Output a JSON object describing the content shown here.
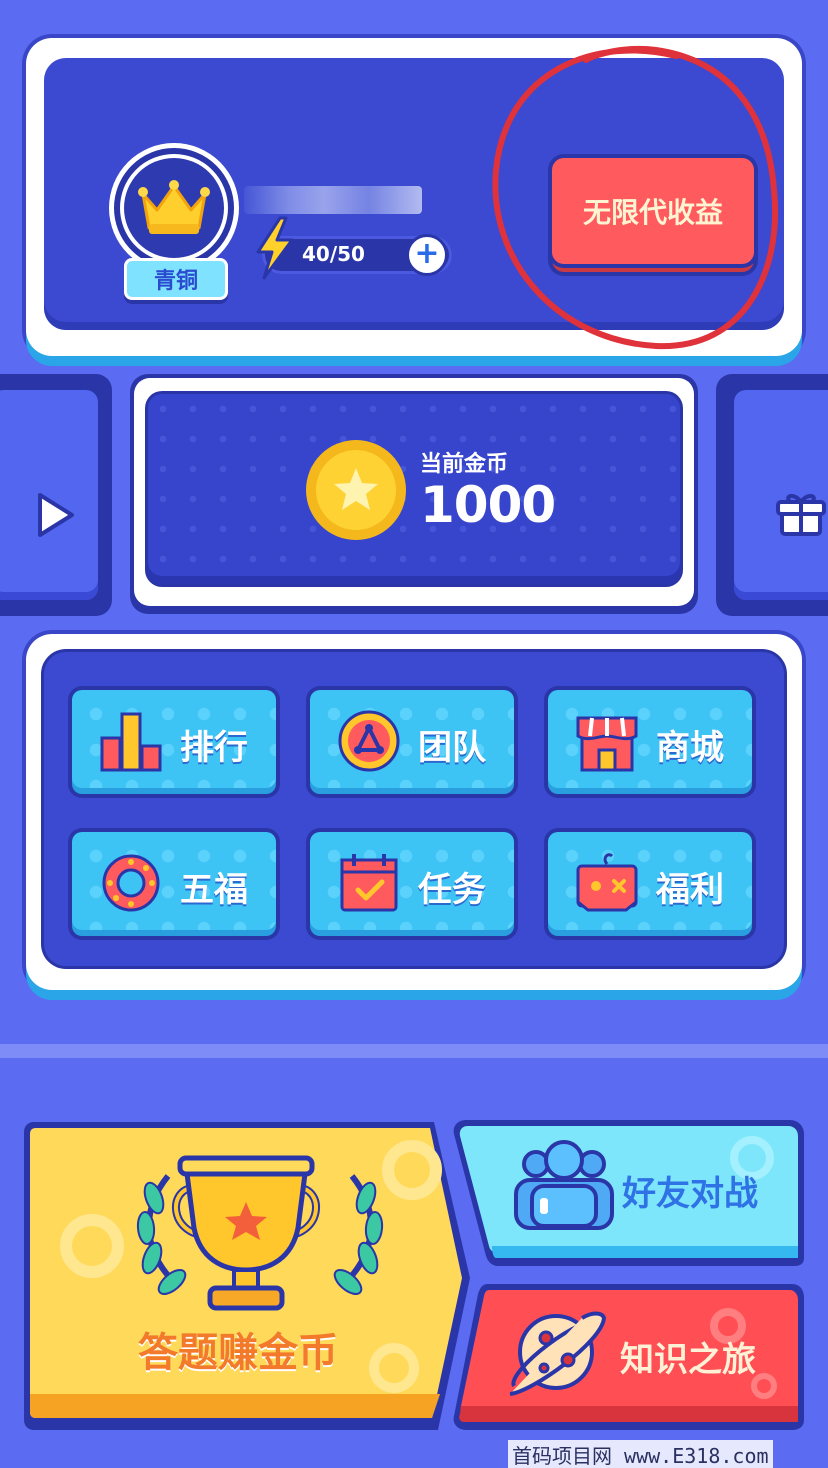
{
  "profile": {
    "rank_badge": "青铜",
    "energy": "40/50",
    "add_energy_symbol": "+",
    "earn_button": "无限代收益"
  },
  "coins": {
    "label": "当前金币",
    "value": "1000"
  },
  "menu": [
    {
      "label": "排行",
      "icon": "bar-chart-icon"
    },
    {
      "label": "团队",
      "icon": "team-icon"
    },
    {
      "label": "商城",
      "icon": "shop-icon"
    },
    {
      "label": "五福",
      "icon": "ring-icon"
    },
    {
      "label": "任务",
      "icon": "calendar-check-icon"
    },
    {
      "label": "福利",
      "icon": "gift-box-icon"
    }
  ],
  "modes": {
    "quiz": "答题赚金币",
    "friend_battle": "好友对战",
    "knowledge_journey": "知识之旅"
  },
  "watermark": "首码项目网 www.E318.com",
  "colors": {
    "background": "#5b6cf2",
    "panel": "#3b4ad0",
    "menu_button": "#3ec3f5",
    "earn_button": "#ff5a5e",
    "quiz_button": "#ffd95a",
    "friend_button": "#7ee6fb",
    "journey_button": "#ff4f55",
    "annotation_circle": "#e0323a"
  }
}
